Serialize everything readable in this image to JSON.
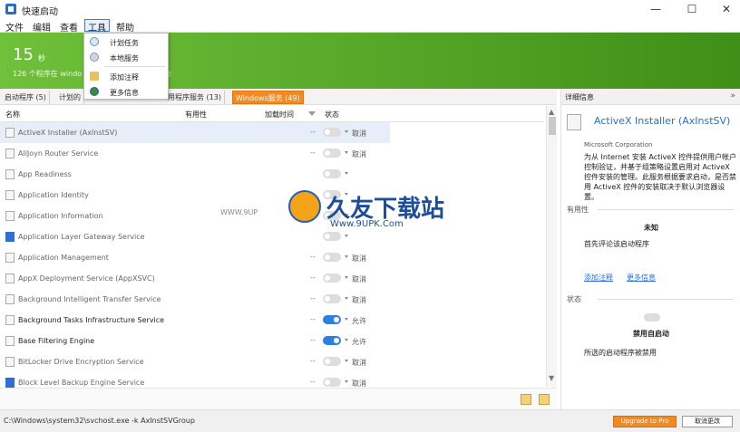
{
  "window": {
    "title": "快速启动",
    "minimize_glyph": "—",
    "maximize_glyph": "☐",
    "close_glyph": "✕"
  },
  "menu": [
    "文件",
    "编辑",
    "查看",
    "工具",
    "帮助"
  ],
  "tools_menu": {
    "items": [
      {
        "label": "计划任务",
        "icon": "clock-icon"
      },
      {
        "label": "本地服务",
        "icon": "services-icon"
      },
      {
        "label": "添加注释",
        "icon": "note-icon"
      },
      {
        "label": "更多信息",
        "icon": "globe-icon"
      }
    ]
  },
  "hero": {
    "count": "15",
    "unit": "秒",
    "subtitle_left": "126 个程序在 windo",
    "subtitle_right": "动"
  },
  "tabs": [
    {
      "label": "启动程序 (5)"
    },
    {
      "label": "计划的"
    },
    {
      "label": "用程序服务 (13)"
    },
    {
      "label": "Windows服务 (49)"
    }
  ],
  "columns": {
    "name": "名称",
    "usefulness": "有用性",
    "load_time": "加载时间",
    "status": "状态"
  },
  "services": [
    {
      "name": "ActiveX Installer (AxInstSV)",
      "load": "--",
      "on": false,
      "status": "取消",
      "icon": "doc",
      "selected": true,
      "bold": false
    },
    {
      "name": "AllJoyn Router Service",
      "load": "--",
      "on": false,
      "status": "取消",
      "icon": "doc",
      "selected": false,
      "bold": false
    },
    {
      "name": "App Readiness",
      "load": "",
      "on": false,
      "status": "",
      "icon": "doc",
      "selected": false,
      "bold": false
    },
    {
      "name": "Application Identity",
      "load": "",
      "on": false,
      "status": "",
      "icon": "doc",
      "selected": false,
      "bold": false
    },
    {
      "name": "Application Information",
      "load": "",
      "on": false,
      "status": "",
      "icon": "doc",
      "selected": false,
      "bold": false
    },
    {
      "name": "Application Layer Gateway Service",
      "load": "",
      "on": false,
      "status": "",
      "icon": "blue",
      "selected": false,
      "bold": false
    },
    {
      "name": "Application Management",
      "load": "--",
      "on": false,
      "status": "取消",
      "icon": "doc",
      "selected": false,
      "bold": false
    },
    {
      "name": "AppX Deployment Service (AppXSVC)",
      "load": "--",
      "on": false,
      "status": "取消",
      "icon": "doc",
      "selected": false,
      "bold": false
    },
    {
      "name": "Background Intelligent Transfer Service",
      "load": "--",
      "on": false,
      "status": "取消",
      "icon": "doc",
      "selected": false,
      "bold": false
    },
    {
      "name": "Background Tasks Infrastructure Service",
      "load": "--",
      "on": true,
      "status": "允许",
      "icon": "doc",
      "selected": false,
      "bold": true
    },
    {
      "name": "Base Filtering Engine",
      "load": "--",
      "on": true,
      "status": "允许",
      "icon": "doc",
      "selected": false,
      "bold": true
    },
    {
      "name": "BitLocker Drive Encryption Service",
      "load": "--",
      "on": false,
      "status": "取消",
      "icon": "doc",
      "selected": false,
      "bold": false
    },
    {
      "name": "Block Level Backup Engine Service",
      "load": "--",
      "on": false,
      "status": "取消",
      "icon": "blue",
      "selected": false,
      "bold": false
    }
  ],
  "detail": {
    "header": "详细信息",
    "collapse_glyph": "»",
    "name": "ActiveX Installer (AxInstSV)",
    "company": "Microsoft Corporation",
    "description": "为从 Internet 安装 ActiveX 控件提供用户帐户控制验证，并基于组策略设置启用对 ActiveX 控件安装的管理。此服务根据要求启动，是否禁用 ActiveX 控件的安装取决于默认浏览器设置。",
    "usefulness_label": "有用性",
    "usefulness_value": "未知",
    "usefulness_hint": "首先评论该启动程序",
    "add_note": "添加注释",
    "more_info": "更多信息",
    "status_label": "状态",
    "status_value": "禁用自启动",
    "status_hint": "所选的启动程序被禁用"
  },
  "watermark": {
    "left": "WWW.9UP",
    "main": "久友下载站",
    "sub": "Www.9UPK.Com"
  },
  "statusbar": {
    "path": "C:\\Windows\\system32\\svchost.exe -k AxInstSVGroup",
    "upgrade": "Upgrade to Pro",
    "cancel": "取消更改"
  },
  "colors": {
    "accent_orange": "#f08a24",
    "hero_green": "#4fa020",
    "toggle_blue": "#2f7fe0",
    "link_blue": "#2a6fd6"
  }
}
